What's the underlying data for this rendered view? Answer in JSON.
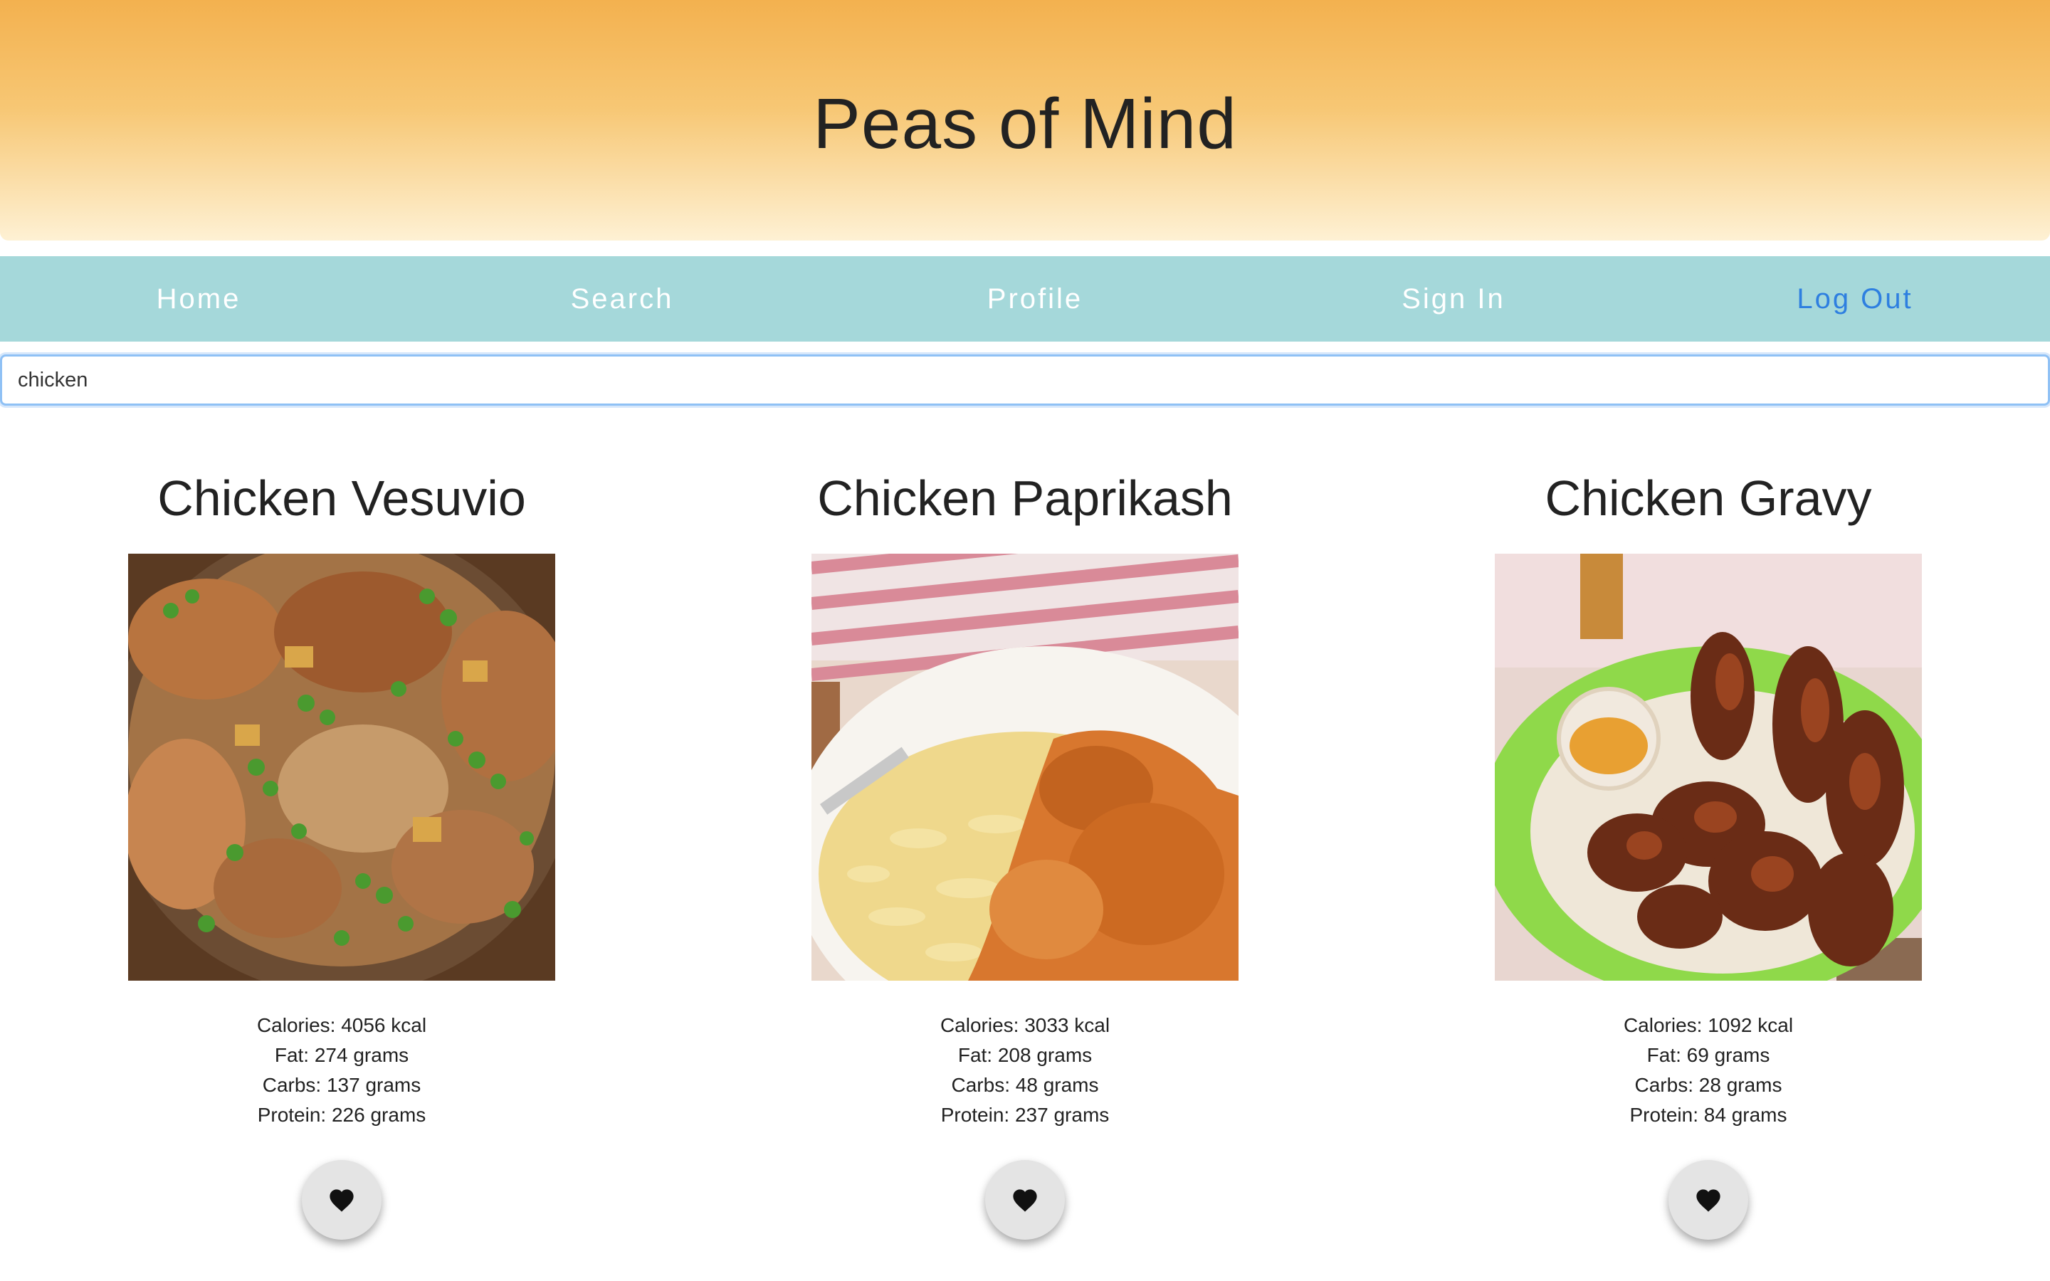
{
  "header": {
    "title": "Peas of Mind"
  },
  "nav": {
    "items": [
      {
        "label": "Home"
      },
      {
        "label": "Search"
      },
      {
        "label": "Profile"
      },
      {
        "label": "Sign In"
      },
      {
        "label": "Log Out"
      }
    ]
  },
  "search": {
    "value": "chicken"
  },
  "results": [
    {
      "title": "Chicken Vesuvio",
      "calories": "Calories: 4056 kcal",
      "fat": "Fat: 274 grams",
      "carbs": "Carbs: 137 grams",
      "protein": "Protein: 226 grams"
    },
    {
      "title": "Chicken Paprikash",
      "calories": "Calories: 3033 kcal",
      "fat": "Fat: 208 grams",
      "carbs": "Carbs: 48 grams",
      "protein": "Protein: 237 grams"
    },
    {
      "title": "Chicken Gravy",
      "calories": "Calories: 1092 kcal",
      "fat": "Fat: 69 grams",
      "carbs": "Carbs: 28 grams",
      "protein": "Protein: 84 grams"
    }
  ],
  "icons": {
    "favorite": "heart-icon"
  },
  "colors": {
    "header_top": "#f3b14f",
    "header_bottom": "#fef1d4",
    "nav_bg": "#a5d8da",
    "nav_text": "#ffffff",
    "active_link": "#2e7fe0"
  }
}
